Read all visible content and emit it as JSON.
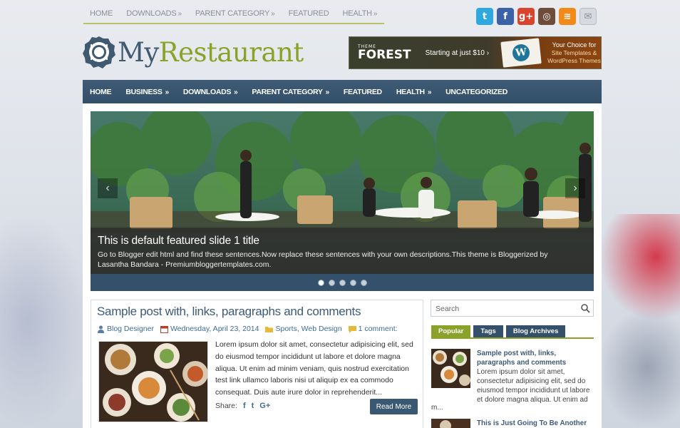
{
  "top_nav": {
    "items": [
      {
        "label": "HOME",
        "has_submenu": false
      },
      {
        "label": "DOWNLOADS",
        "has_submenu": true
      },
      {
        "label": "PARENT CATEGORY",
        "has_submenu": true
      },
      {
        "label": "FEATURED",
        "has_submenu": false
      },
      {
        "label": "HEALTH",
        "has_submenu": true
      }
    ],
    "submenu_glyph": "»"
  },
  "social": {
    "icons": [
      {
        "name": "twitter-icon",
        "glyph": "t",
        "color": "#2fa8e0"
      },
      {
        "name": "facebook-icon",
        "glyph": "f",
        "color": "#3b62a8"
      },
      {
        "name": "google-plus-icon",
        "glyph": "g+",
        "color": "#d9442f"
      },
      {
        "name": "instagram-icon",
        "glyph": "◎",
        "color": "#6d4c3a"
      },
      {
        "name": "rss-icon",
        "glyph": "≋",
        "color": "#f28a1a"
      },
      {
        "name": "email-icon",
        "glyph": "✉",
        "color": "#d6d9de"
      }
    ]
  },
  "logo": {
    "part1": "My",
    "part2": "Restaurant"
  },
  "banner": {
    "brand_small": "THEME",
    "brand": "FOREST",
    "tagline": "Starting at just $10 ›",
    "wp_glyph": "W",
    "right_line1": "Your Choice for",
    "right_line2": "Site Templates &",
    "right_line3": "WordPress Themes"
  },
  "main_nav": {
    "items": [
      {
        "label": "HOME",
        "has_submenu": false
      },
      {
        "label": "BUSINESS",
        "has_submenu": true
      },
      {
        "label": "DOWNLOADS",
        "has_submenu": true
      },
      {
        "label": "PARENT CATEGORY",
        "has_submenu": true
      },
      {
        "label": "FEATURED",
        "has_submenu": false
      },
      {
        "label": "HEALTH",
        "has_submenu": true
      },
      {
        "label": "UNCATEGORIZED",
        "has_submenu": false
      }
    ],
    "submenu_glyph": "»"
  },
  "slider": {
    "title": "This is default featured slide 1 title",
    "description": "Go to Blogger edit html and find these sentences.Now replace these sentences with your own descriptions.This theme is Bloggerized by Lasantha Bandara - Premiumbloggertemplates.com.",
    "prev_glyph": "‹",
    "next_glyph": "›",
    "slide_count": 5,
    "active_slide": 1
  },
  "post": {
    "title": "Sample post with, links, paragraphs and comments",
    "author": "Blog Designer",
    "date": "Wednesday, April 23, 2014",
    "labels": "Sports, Web Design",
    "comments": "1 comment:",
    "excerpt": "Lorem ipsum dolor sit amet, consectetur adipisicing elit, sed do eiusmod tempor incididunt ut labore et dolore magna aliqua. Ut enim ad minim veniam, quis nostrud exercitation test link ullamco laboris nisi ut aliquip ex ea commodo consequat. Duis aute irure dolor in reprehenderit...",
    "share_label": "Share:",
    "share_icons": [
      {
        "name": "facebook-share-icon",
        "glyph": "f"
      },
      {
        "name": "twitter-share-icon",
        "glyph": "t"
      },
      {
        "name": "google-plus-share-icon",
        "glyph": "G+"
      }
    ],
    "read_more": "Read More"
  },
  "sidebar": {
    "search_placeholder": "Search",
    "tabs": [
      {
        "label": "Popular",
        "active": true
      },
      {
        "label": "Tags",
        "active": false
      },
      {
        "label": "Blog Archives",
        "active": false
      }
    ],
    "popular": [
      {
        "title": "Sample post with, links, paragraphs and comments",
        "excerpt": "Lorem ipsum dolor sit amet, consectetur adipisicing elit, sed do eiusmod tempor incididunt ut labore et dolore magna aliqua. Ut enim ad",
        "more": "m..."
      },
      {
        "title": "This is Just Going To Be Another",
        "excerpt": "",
        "more": ""
      }
    ]
  },
  "colors": {
    "accent_green": "#8aa12a",
    "nav_blue": "#34506a",
    "link_blue": "#3d5a78"
  }
}
